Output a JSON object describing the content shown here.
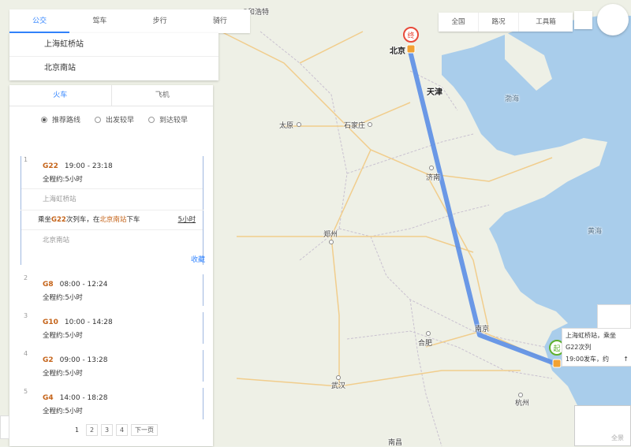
{
  "map": {
    "cities": [
      {
        "name": "和浩特",
        "kind": "city"
      },
      {
        "name": "北京",
        "kind": "big"
      },
      {
        "name": "天津",
        "kind": "big"
      },
      {
        "name": "太原",
        "kind": "city"
      },
      {
        "name": "石家庄",
        "kind": "city"
      },
      {
        "name": "济南",
        "kind": "city"
      },
      {
        "name": "郑州",
        "kind": "city"
      },
      {
        "name": "南京",
        "kind": "city"
      },
      {
        "name": "合肥",
        "kind": "city"
      },
      {
        "name": "武汉",
        "kind": "city"
      },
      {
        "name": "杭州",
        "kind": "city"
      },
      {
        "name": "南昌",
        "kind": "city"
      },
      {
        "name": "渤海",
        "kind": "sea"
      },
      {
        "name": "黄海",
        "kind": "sea"
      }
    ],
    "end_marker": "终",
    "start_marker": "起",
    "route_color": "#5b8ee6"
  },
  "mode_tabs": [
    "公交",
    "驾车",
    "步行",
    "骑行"
  ],
  "route": {
    "from": "上海虹桥站",
    "to": "北京南站"
  },
  "sub_tabs": [
    "火车",
    "飞机"
  ],
  "sort_options": [
    "推荐路线",
    "出发较早",
    "到达较早"
  ],
  "trains": [
    {
      "index": "1",
      "code": "G22",
      "time": "19:00 - 23:18",
      "dur_label": "全程约:",
      "duration": "5小时"
    },
    {
      "index": "2",
      "code": "G8",
      "time": "08:00 - 12:24",
      "dur_label": "全程约:",
      "duration": "5小时"
    },
    {
      "index": "3",
      "code": "G10",
      "time": "10:00 - 14:28",
      "dur_label": "全程约:",
      "duration": "5小时"
    },
    {
      "index": "4",
      "code": "G2",
      "time": "09:00 - 13:28",
      "dur_label": "全程约:",
      "duration": "5小时"
    },
    {
      "index": "5",
      "code": "G4",
      "time": "14:00 - 18:28",
      "dur_label": "全程约:",
      "duration": "5小时"
    }
  ],
  "expanded": {
    "from_station": "上海虹桥站",
    "transfer_prefix": "乘坐",
    "transfer_train": "G22",
    "transfer_mid": "次列车，在",
    "transfer_station": "北京南站",
    "transfer_suffix": "下车",
    "transfer_duration": "5小时",
    "to_station": "北京南站",
    "collapse": "收藏"
  },
  "pager": {
    "pages": [
      "1",
      "2",
      "3",
      "4"
    ],
    "next": "下一页"
  },
  "tools": [
    "全国",
    "路况",
    "工具箱"
  ],
  "info_label": {
    "line1": "上海虹桥站，乘坐G22次列",
    "line2": "19:00发车，约",
    "arrow": "↑"
  },
  "overview_label": "全景"
}
